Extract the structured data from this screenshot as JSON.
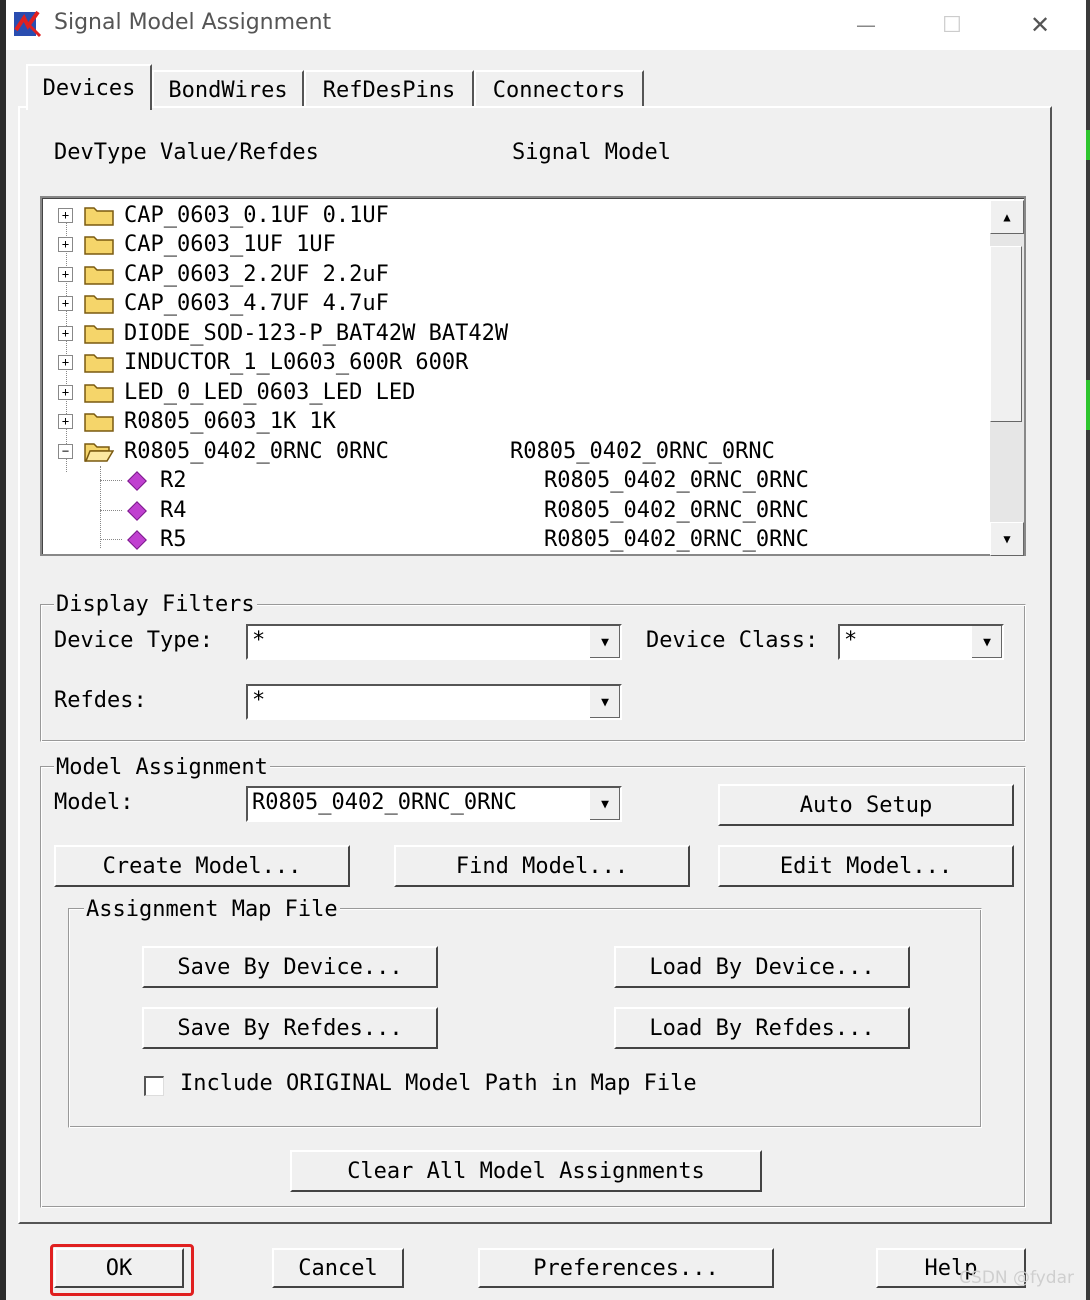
{
  "window": {
    "title": "Signal Model Assignment",
    "controls": {
      "minimize": "—",
      "maximize": "☐",
      "close": "✕"
    }
  },
  "tabs": [
    {
      "label": "Devices",
      "active": true
    },
    {
      "label": "BondWires",
      "active": false
    },
    {
      "label": "RefDesPins",
      "active": false
    },
    {
      "label": "Connectors",
      "active": false
    }
  ],
  "columns": {
    "left": "DevType Value/Refdes",
    "right": "Signal Model"
  },
  "tree": {
    "rows": [
      {
        "label": "CAP_0603_0.1UF 0.1UF",
        "model": "",
        "kind": "folder",
        "expanded": false
      },
      {
        "label": "CAP_0603_1UF 1UF",
        "model": "",
        "kind": "folder",
        "expanded": false
      },
      {
        "label": "CAP_0603_2.2UF 2.2uF",
        "model": "",
        "kind": "folder",
        "expanded": false
      },
      {
        "label": "CAP_0603_4.7UF 4.7uF",
        "model": "",
        "kind": "folder",
        "expanded": false
      },
      {
        "label": "DIODE_SOD-123-P_BAT42W BAT42W",
        "model": "",
        "kind": "folder",
        "expanded": false
      },
      {
        "label": "INDUCTOR_1_L0603_600R 600R",
        "model": "",
        "kind": "folder",
        "expanded": false
      },
      {
        "label": "LED_0_LED_0603_LED LED",
        "model": "",
        "kind": "folder",
        "expanded": false
      },
      {
        "label": "R0805_0603_1K 1K",
        "model": "",
        "kind": "folder",
        "expanded": false
      },
      {
        "label": "R0805_0402_0RNC 0RNC",
        "model": "R0805_0402_0RNC_0RNC",
        "kind": "folder",
        "expanded": true
      },
      {
        "label": "R2",
        "model": "R0805_0402_0RNC_0RNC",
        "kind": "part"
      },
      {
        "label": "R4",
        "model": "R0805_0402_0RNC_0RNC",
        "kind": "part"
      },
      {
        "label": "R5",
        "model": "R0805_0402_0RNC_0RNC",
        "kind": "part"
      }
    ]
  },
  "display_filters": {
    "legend": "Display Filters",
    "device_type_label": "Device Type:",
    "device_type_value": "*",
    "device_class_label": "Device Class:",
    "device_class_value": "*",
    "refdes_label": "Refdes:",
    "refdes_value": "*"
  },
  "model_assignment": {
    "legend": "Model Assignment",
    "model_label": "Model:",
    "model_value": "R0805_0402_0RNC_0RNC",
    "auto_setup": "Auto Setup",
    "create_model": "Create Model...",
    "find_model": "Find Model...",
    "edit_model": "Edit Model...",
    "map_file": {
      "legend": "Assignment Map File",
      "save_by_device": "Save By Device...",
      "load_by_device": "Load By Device...",
      "save_by_refdes": "Save By Refdes...",
      "load_by_refdes": "Load By Refdes...",
      "include_original_label": "Include ORIGINAL Model Path in Map File",
      "include_original_checked": false
    },
    "clear_all": "Clear All Model Assignments"
  },
  "footer": {
    "ok": "OK",
    "cancel": "Cancel",
    "preferences": "Preferences...",
    "help": "Help"
  },
  "watermark": "CSDN @fydar",
  "colors": {
    "highlight": "#e02020",
    "part_icon": "#c040d0",
    "folder": "#f5d56a"
  },
  "icons": {
    "app": "signal-model-app-icon",
    "folder_closed": "folder-icon",
    "folder_open": "folder-open-icon",
    "part": "component-diamond-icon"
  }
}
